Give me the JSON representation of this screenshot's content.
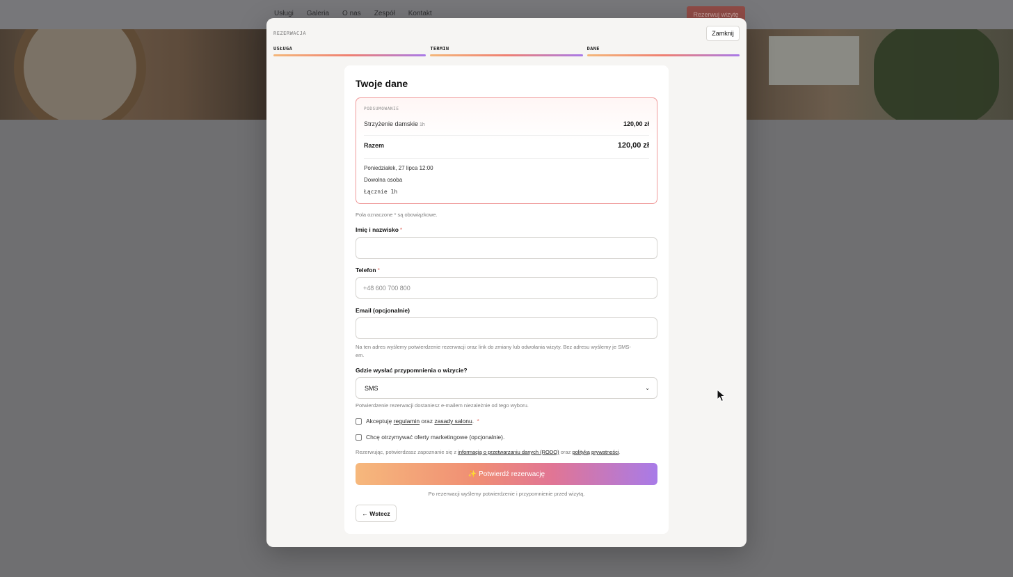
{
  "background": {
    "nav": [
      "Usługi",
      "Galeria",
      "O nas",
      "Zespół",
      "Kontakt"
    ],
    "nav_cta": "Rezerwuj wizytę"
  },
  "modal": {
    "eyebrow": "REZERWACJA",
    "close_label": "Zamknij",
    "steps": [
      "USŁUGA",
      "TERMIN",
      "DANE"
    ],
    "title": "Twoje dane",
    "summary": {
      "eyebrow": "PODSUMOWANIE",
      "service_name": "Strzyżenie damskie",
      "service_duration": "1h",
      "service_price": "120,00 zł",
      "total_label": "Razem",
      "total_price": "120,00 zł",
      "date": "Poniedziałek, 27 lipca 12:00",
      "staff": "Dowolna osoba",
      "total_time": "Łącznie 1h"
    },
    "required_hint": "Pola oznaczone * są obowiązkowe.",
    "fields": {
      "name_label": "Imię i nazwisko",
      "name_value": "",
      "phone_label": "Telefon",
      "phone_placeholder": "+48 600 700 800",
      "email_label": "Email (opcjonalnie)",
      "email_value": "",
      "email_hint_1": "Na ten adres wyślemy potwierdzenie rezerwacji oraz link do zmiany lub odwołania wizyty. Bez adresu wyślemy je SMS-",
      "email_hint_2": "em.",
      "reminder_label": "Gdzie wysłać przypomnienia o wizycie?",
      "reminder_value": "SMS",
      "reminder_hint": "Potwierdzenie rezerwacji dostaniesz e-mailem niezależnie od tego wyboru."
    },
    "terms": {
      "prefix": "Akceptuję",
      "link1": "regulamin",
      "mid": "oraz",
      "link2": "zasady salonu",
      "suffix": "."
    },
    "marketing": "Chcę otrzymywać oferty marketingowe (opcjonalnie).",
    "rodo": {
      "prefix": "Rezerwując, potwierdzasz zapoznanie się z",
      "link1": "informacją o przetwarzaniu danych (RODO)",
      "mid": "oraz",
      "link2": "polityką prywatności",
      "suffix": "."
    },
    "cta": "✨ Potwierdź rezerwację",
    "cta_note": "Po rezerwacji wyślemy potwierdzenie i przypomnienie przed wizytą.",
    "back": "← Wstecz"
  },
  "colors": {
    "accent_start": "#f6b87c",
    "accent_mid": "#f08e74",
    "accent_end": "#a87be8",
    "required": "#e0736b",
    "summary_border": "#ef9a9a"
  }
}
